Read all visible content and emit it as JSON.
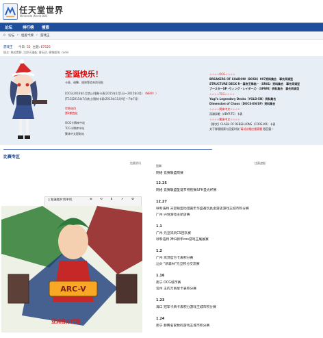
{
  "header": {
    "site_title": "任天堂世界",
    "site_subtitle": "Nintendo World BBS"
  },
  "nav": {
    "items": [
      "论坛",
      "排行榜",
      "搜索"
    ]
  },
  "breadcrumb": {
    "items": [
      "论坛",
      "›",
      "怪兽卡牌",
      "›",
      "游戏王"
    ]
  },
  "forum": {
    "name": "游戏王",
    "today_label": "今日:",
    "today_value": "52",
    "topics_label": "主题:",
    "topics_value": "67525",
    "moderators": "版主: 暗凶黑野, 泣舒天潘淼, 曾无初, 德城般海, codei"
  },
  "info": {
    "greeting": "圣诞快乐！",
    "intro": "卡表、调整、规则等综合资讯贴",
    "ban_ocg_prefix": "[OCG]2016年1月禁止/限制卡表(2015年1月1日～2015年3月) ",
    "ban_ocg_new": "（NEW！）",
    "ban_tcg": "[TCG]2015年7月禁止/限制卡表(2015年11月9日～7年7月)",
    "world_champ": "世界选目",
    "new_cards": "第9期宫化",
    "ocg_db": "OCG卡牌库中站",
    "tcg_db": "TCG卡牌库中站",
    "text_db": "繁体中文提取站"
  },
  "releases": {
    "ocg_head": "☆☆☆☆OCG☆☆☆☆",
    "ocg_lines": [
      "BREAKERS OF SHADOW（BOSH）907资料集合　事先同调型",
      "STRUCTURE DECK R－真帝王降临－（SR01）资料集合　事先同调型",
      "ブースターSP -ウィング・レイダーズ-（SPWR）资料集合　事先同调型"
    ],
    "tcg_head": "☆☆☆☆TCG☆☆☆☆",
    "tcg_lines": [
      "Yugi's Legendary Decks（YGLD-EN）资料集合",
      "Dimension of Chaos（DOCS-EN/SP）资料集合"
    ],
    "simp_head": "☆☆☆☆简体中文☆☆☆☆",
    "simp_lines": [
      "深渊异眠（ABYR-TC）卡表"
    ],
    "trad_head": "☆☆☆☆繁体中文☆☆☆☆",
    "trad_lines": [
      "【胖文】CLASH OF REBELLIONS（CORE-KR）卡表"
    ],
    "footer_prefix": "关于胖版搜索与回复时说 ",
    "footer_link": "请试试相应搜索题",
    "footer_suffix": " 版回复~"
  },
  "matches": {
    "section_title": "比赛专区",
    "left_header": "比赛资讯",
    "mid_header": "图腾",
    "right_header": "比赛战报",
    "schedule": [
      {
        "date": "",
        "items": [
          "网络 竞赛联盟周赛"
        ]
      },
      {
        "date": "12.25",
        "items": [
          "网络 竞赛联盟圣诞节特别赛&FH圣光杯赛"
        ]
      },
      {
        "date": "12.27",
        "items": [
          "呼和浩特 天空联盟动漫嘉年华盛邀玩具桌游店游戏王城市积分赛",
          "广州 兴悦游戏王新店赛"
        ]
      },
      {
        "date": "1.1",
        "items": [
          "广州 元旦岚玩CS团队赛",
          "呼和浩特 神归新年cos游戏王展展赛"
        ]
      },
      {
        "date": "1.2",
        "items": [
          "广州 岚顶官方卡表积分赛",
          "汕头 \"新森林\"元旦积分交流赛"
        ]
      },
      {
        "date": "1.16",
        "items": [
          "南宁 OCG城市赛",
          "常州 王的万事屋卡表积分赛"
        ]
      },
      {
        "date": "1.23",
        "items": [
          "海口 冠军卡牌卡表积分游戏王城市积分赛"
        ]
      },
      {
        "date": "1.24",
        "items": [
          "南宁 赫腾名家数码游戏王城市积分赛"
        ]
      }
    ]
  },
  "ad": {
    "send_label": "发送图片到手机",
    "caption": "亚洲官方代理",
    "banner_text": "ARC-V"
  }
}
